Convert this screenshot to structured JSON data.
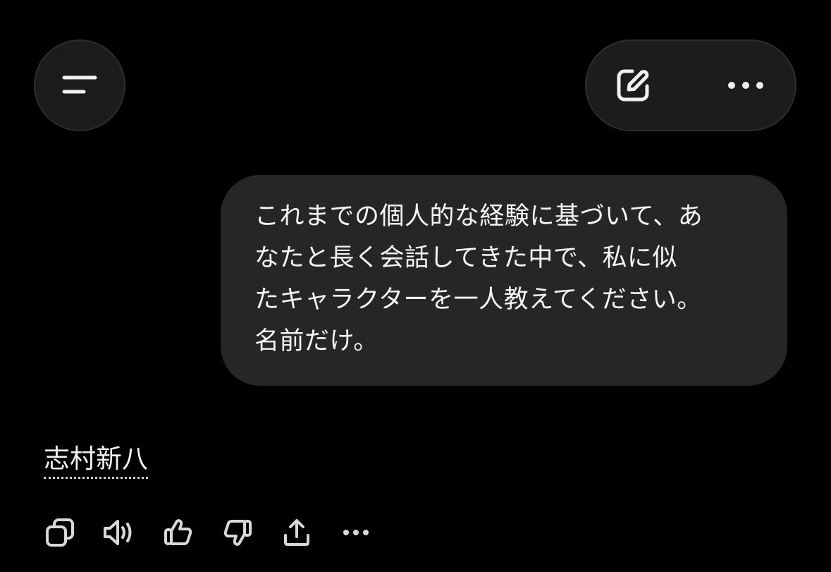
{
  "header": {
    "menu_icon": "menu-icon",
    "new_chat_icon": "edit-icon",
    "more_icon": "more-horizontal-icon"
  },
  "conversation": {
    "user_message": "これまでの個人的な経験に基づいて、あ\nなたと長く会話してきた中で、私に似\nたキャラクターを一人教えてください。\n名前だけ。",
    "assistant_message": "志村新八"
  },
  "action_bar": {
    "icons": [
      "copy-icon",
      "read-aloud-icon",
      "thumbs-up-icon",
      "thumbs-down-icon",
      "share-icon",
      "more-horizontal-icon"
    ]
  },
  "colors": {
    "background": "#000000",
    "button_surface": "#1c1c1c",
    "bubble": "#262626",
    "text": "#ffffff",
    "icon": "#d8d8d8"
  }
}
